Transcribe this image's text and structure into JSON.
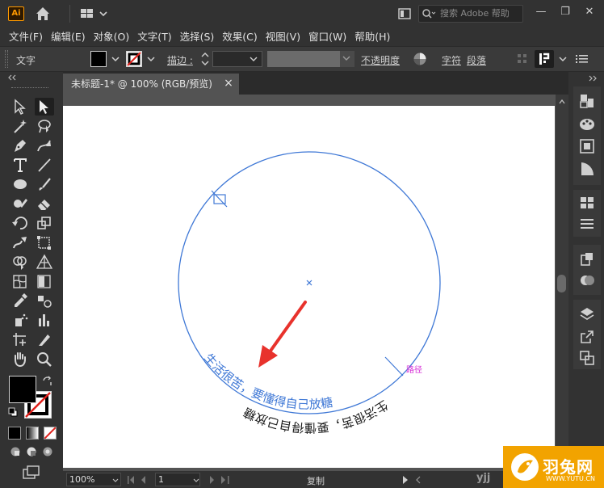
{
  "app": {
    "logo_text": "Ai",
    "search_placeholder": "搜索 Adobe 帮助",
    "window_controls": [
      "—",
      "❐",
      "✕"
    ]
  },
  "menubar": {
    "items": [
      "文件(F)",
      "编辑(E)",
      "对象(O)",
      "文字(T)",
      "选择(S)",
      "效果(C)",
      "视图(V)",
      "窗口(W)",
      "帮助(H)"
    ]
  },
  "controlbar": {
    "object_type": "文字",
    "stroke_label": "描边 :",
    "opacity_label": "不透明度",
    "character_label": "字符",
    "paragraph_label": "段落"
  },
  "document": {
    "tab_title": "未标题-1* @ 100% (RGB/预览)",
    "close_glyph": "×"
  },
  "canvas": {
    "path_text_blue": "生活很苦，要懂得自己放糖",
    "path_text_black": "生活很苦，要懂得自己放糖",
    "path_hint": "路径",
    "accent_blue": "#3f78d6",
    "hint_color": "#d62ad6",
    "arrow_color": "#e8322c"
  },
  "statusbar": {
    "zoom": "100%",
    "artboard": "1",
    "status": "复制"
  },
  "watermark": {
    "text": "羽兔网",
    "url": "WWW.YUTU.CN",
    "partial_text": "yjj"
  }
}
